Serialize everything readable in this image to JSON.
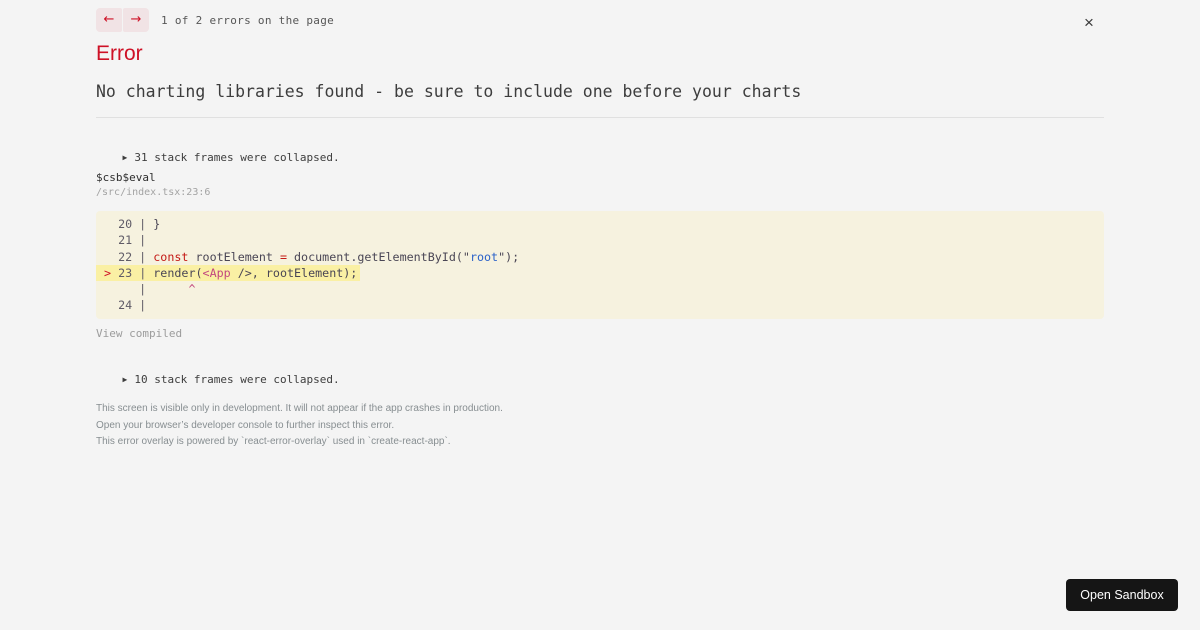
{
  "colors": {
    "background": "#f4f4f4",
    "accent_red": "#ce1126",
    "cta_black": "#151515",
    "code_block_bg": "#f6f2df",
    "code_highlight_bg": "#faf0a4"
  },
  "nav": {
    "prev_icon": "←",
    "next_icon": "→",
    "counter": "1 of 2 errors on the page",
    "close_icon": "×"
  },
  "error": {
    "title": "Error",
    "message": "No charting libraries found - be sure to include one before your charts"
  },
  "stack": {
    "collapsed_top_icon": "▶",
    "collapsed_top": "31 stack frames were collapsed.",
    "frame_function": "$csb$eval",
    "frame_location": "/src/index.tsx:23:6",
    "view_compiled": "View compiled",
    "collapsed_bottom_icon": "▶",
    "collapsed_bottom": "10 stack frames were collapsed."
  },
  "code": {
    "palette": {
      "gutter": "#5f5b66",
      "base": "#4a4655",
      "keyword": "#c41a16",
      "string": "#2c63c9",
      "tag": "#c2477f",
      "marker": "#ce1126",
      "caret": "#c2477f"
    },
    "lines": [
      {
        "highlight": false,
        "segments": [
          {
            "t": "  20 | ",
            "c": "gutter"
          },
          {
            "t": "}",
            "c": "base"
          }
        ]
      },
      {
        "highlight": false,
        "segments": [
          {
            "t": "  21 |",
            "c": "gutter"
          }
        ]
      },
      {
        "highlight": false,
        "segments": [
          {
            "t": "  22 | ",
            "c": "gutter"
          },
          {
            "t": "const",
            "c": "keyword"
          },
          {
            "t": " rootElement ",
            "c": "base"
          },
          {
            "t": "=",
            "c": "keyword"
          },
          {
            "t": " document.getElementById(\"",
            "c": "base"
          },
          {
            "t": "root",
            "c": "string"
          },
          {
            "t": "\");",
            "c": "base"
          }
        ]
      },
      {
        "highlight": true,
        "segments": [
          {
            "t": "> ",
            "c": "marker"
          },
          {
            "t": "23 | ",
            "c": "gutter"
          },
          {
            "t": "render(",
            "c": "base"
          },
          {
            "t": "<App",
            "c": "tag"
          },
          {
            "t": " />, rootElement);",
            "c": "base"
          }
        ]
      },
      {
        "highlight": false,
        "segments": [
          {
            "t": "     |",
            "c": "gutter"
          },
          {
            "t": "      ",
            "c": "base"
          },
          {
            "t": "^",
            "c": "caret"
          }
        ]
      },
      {
        "highlight": false,
        "segments": [
          {
            "t": "  24 |",
            "c": "gutter"
          }
        ]
      }
    ]
  },
  "footer": {
    "lines": [
      "This screen is visible only in development. It will not appear if the app crashes in production.",
      "Open your browser’s developer console to further inspect this error.",
      "This error overlay is powered by `react-error-overlay` used in `create-react-app`."
    ]
  },
  "cta": {
    "label": "Open Sandbox"
  }
}
